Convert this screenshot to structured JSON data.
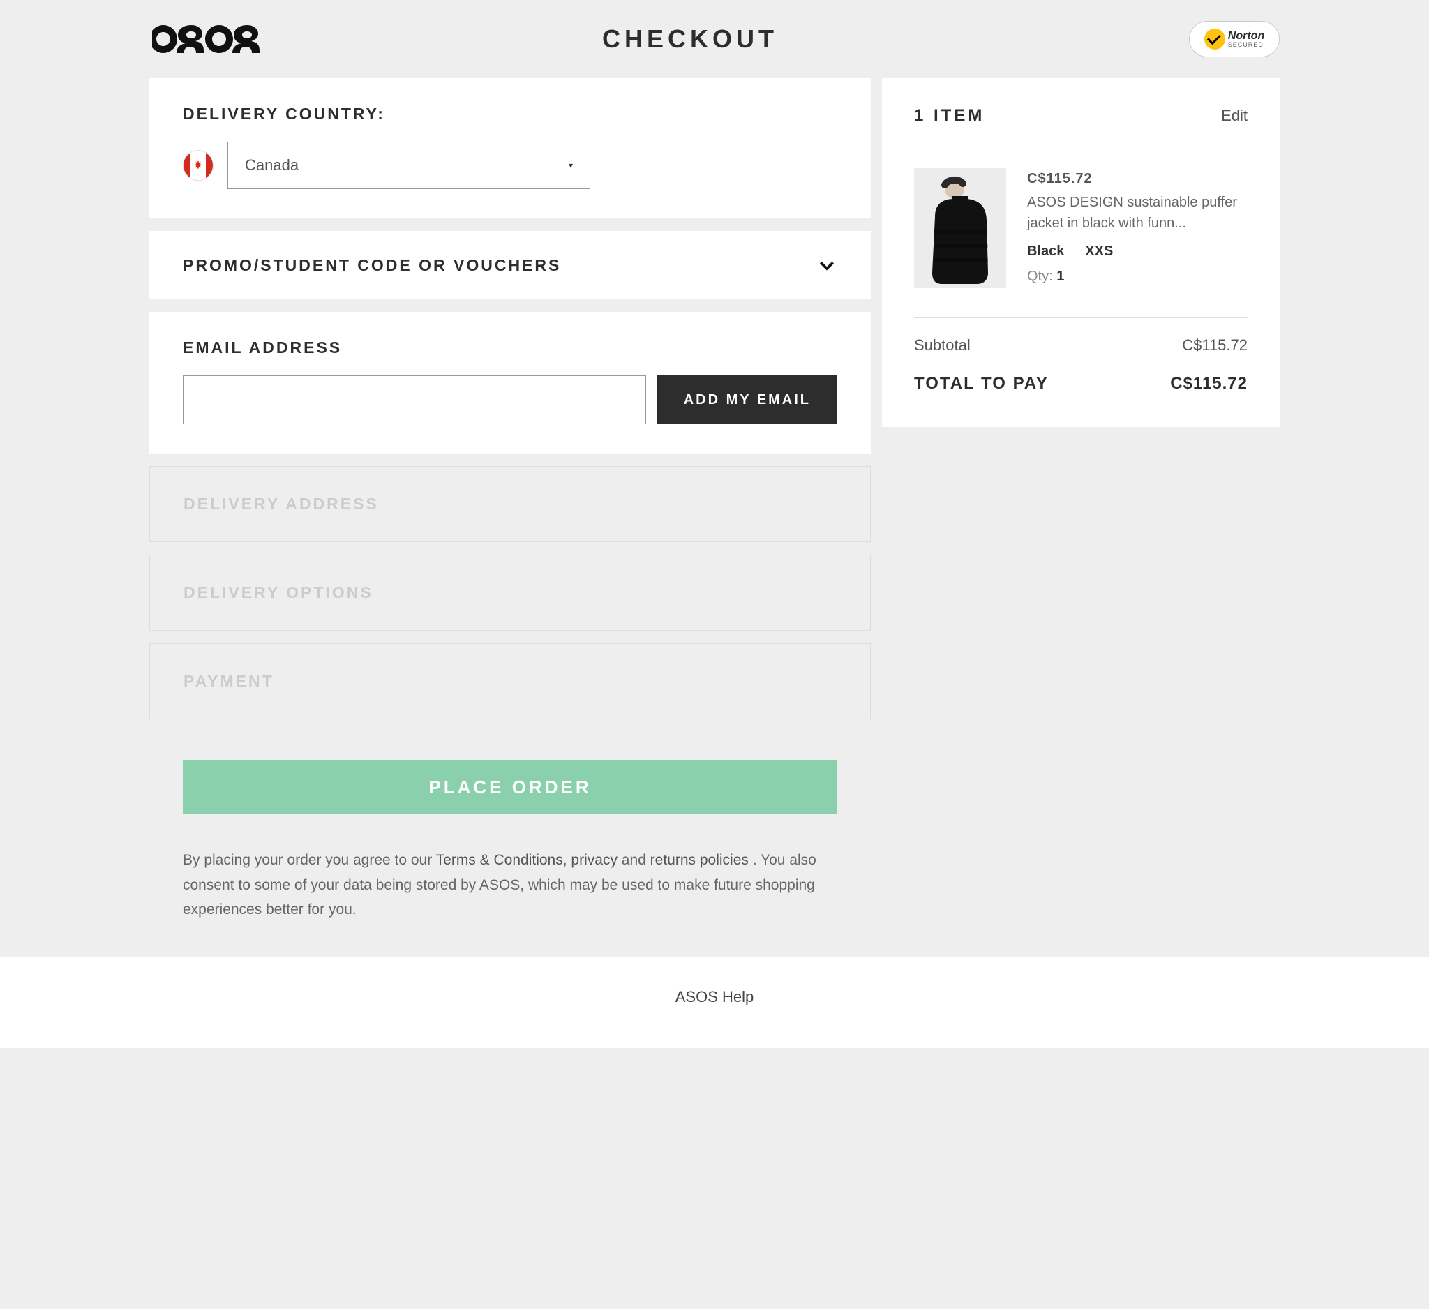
{
  "header": {
    "logo": "asos",
    "title": "CHECKOUT",
    "norton_line1": "Norton",
    "norton_line2": "SECURED"
  },
  "delivery_country": {
    "label": "DELIVERY COUNTRY:",
    "selected": "Canada"
  },
  "promo": {
    "label": "PROMO/STUDENT CODE OR VOUCHERS"
  },
  "email": {
    "label": "EMAIL ADDRESS",
    "value": "",
    "button": "ADD MY EMAIL"
  },
  "disabled_sections": {
    "delivery_address": "DELIVERY ADDRESS",
    "delivery_options": "DELIVERY OPTIONS",
    "payment": "PAYMENT"
  },
  "place_order": "PLACE ORDER",
  "legal": {
    "part1": "By placing your order you agree to our ",
    "terms": "Terms & Conditions",
    "sep1": ", ",
    "privacy": "privacy",
    "sep2": " and ",
    "returns": "returns policies",
    "part2": " . You also consent to some of your data being stored by ASOS, which may be used to make future shopping experiences better for you."
  },
  "summary": {
    "count_label": "1 ITEM",
    "edit": "Edit",
    "item": {
      "price": "C$115.72",
      "name": "ASOS DESIGN sustainable puffer jacket in black with funn...",
      "color": "Black",
      "size": "XXS",
      "qty_label": "Qty:",
      "qty": "1"
    },
    "subtotal_label": "Subtotal",
    "subtotal": "C$115.72",
    "total_label": "TOTAL TO PAY",
    "total": "C$115.72"
  },
  "footer": {
    "help": "ASOS Help"
  }
}
